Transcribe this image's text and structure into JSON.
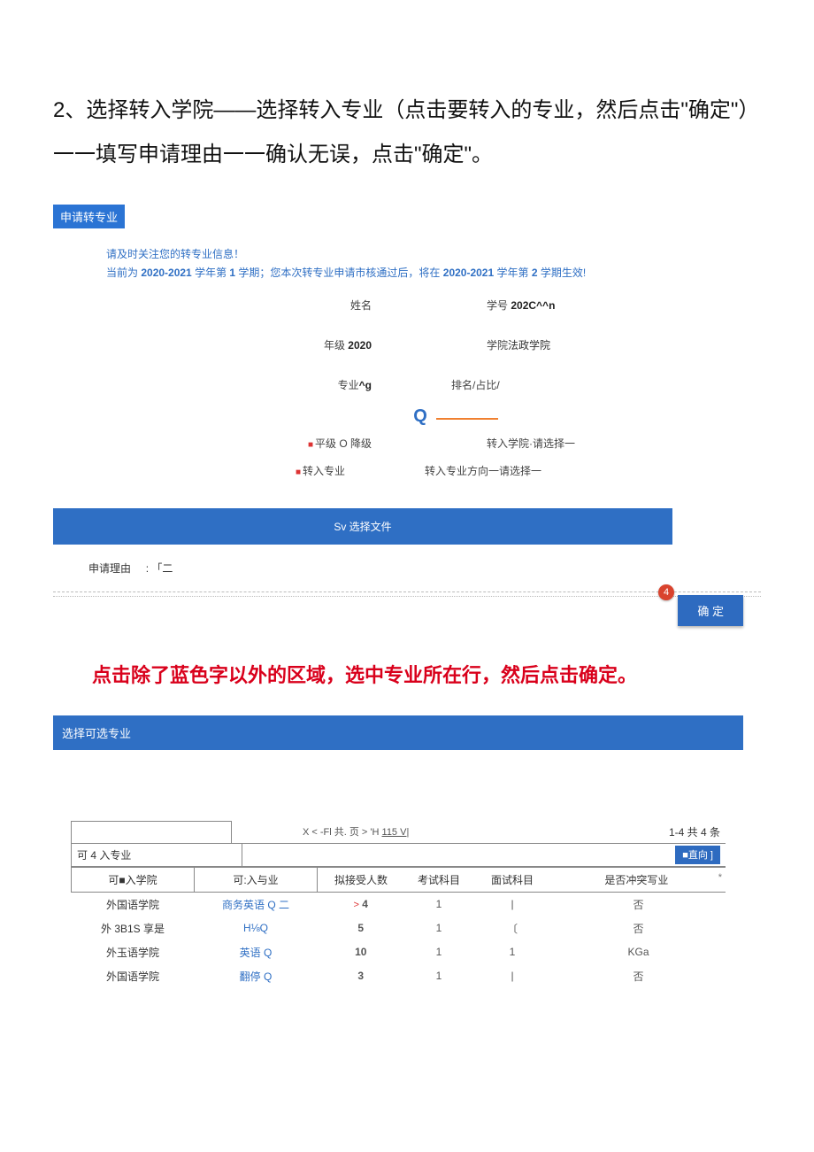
{
  "step_title": "2、选择转入学院——选择转入专业（点击要转入的专业，然后点击\"确定\"）一一填写申请理由一一确认无误，点击\"确定\"。",
  "apply_tag": "申请转专业",
  "notice1": "请及时关注您的转专业信息！",
  "notice2_prefix": "当前为 ",
  "notice2_year": "2020-2021",
  "notice2_mid1": " 学年第 ",
  "notice2_sem1": "1",
  "notice2_mid2": " 学期；您本次转专业申请市核通过后，将在 ",
  "notice2_year2": "2020-2021",
  "notice2_mid3": " 学年第 ",
  "notice2_sem2": "2",
  "notice2_end": " 学期生效!",
  "info": {
    "name_lbl": "姓名",
    "sno_lbl": "学号",
    "sno_val": "202C^^n",
    "grade_lbl": "年级",
    "grade_val": "2020",
    "college_lbl": "学院",
    "college_val": "法政学院",
    "major_lbl": "专业",
    "major_val": "^g",
    "rank_lbl": "排名/占比",
    "rank_val": "/",
    "level_lbl": "平级 O 降级",
    "target_col_lbl": "转入学院·请选择一",
    "target_major_lbl": "转入专业",
    "target_dir_lbl": "转入专业方向一请选择一"
  },
  "file_bar": "Sv 选择文件",
  "reason_lbl": "申请理由",
  "reason_val": ":  「二",
  "badge": "4",
  "confirm_btn": "确 定",
  "red_instr": "点击除了蓝色字以外的区域，选中专业所在行，然后点击确定。",
  "select_bar": "选择可选专业",
  "pager_mid": "X <  -Fl 共.  页 >  'H ",
  "pager_link": "115 V|",
  "pager_right": "1-4 共 4 条",
  "head_label": "可 4 入专业",
  "query_btn": "■直向 ]",
  "cols": {
    "c1": "可■入学院",
    "c2": "可:入与业",
    "c3": "拟接受人数",
    "c4": "考试科目",
    "c5": "面试科目",
    "c6": "是否冲突写业"
  },
  "rows": [
    {
      "college": "外国语学院",
      "major": "商务英语 Q 二",
      "num": "4",
      "exam": "1",
      "interview": "|",
      "conflict": "否",
      "arrow": ">"
    },
    {
      "college": "外 3B1S 享是",
      "major": "H⅛Q",
      "num": "5",
      "exam": "1",
      "interview": "〔",
      "conflict": "否",
      "arrow": ""
    },
    {
      "college": "外玉语学院",
      "major": "英语 Q",
      "num": "10",
      "exam": "1",
      "interview": "1",
      "conflict": "KGa",
      "arrow": ""
    },
    {
      "college": "外国语学院",
      "major": "翻停 Q",
      "num": "3",
      "exam": "1",
      "interview": "|",
      "conflict": "否",
      "arrow": ""
    }
  ]
}
